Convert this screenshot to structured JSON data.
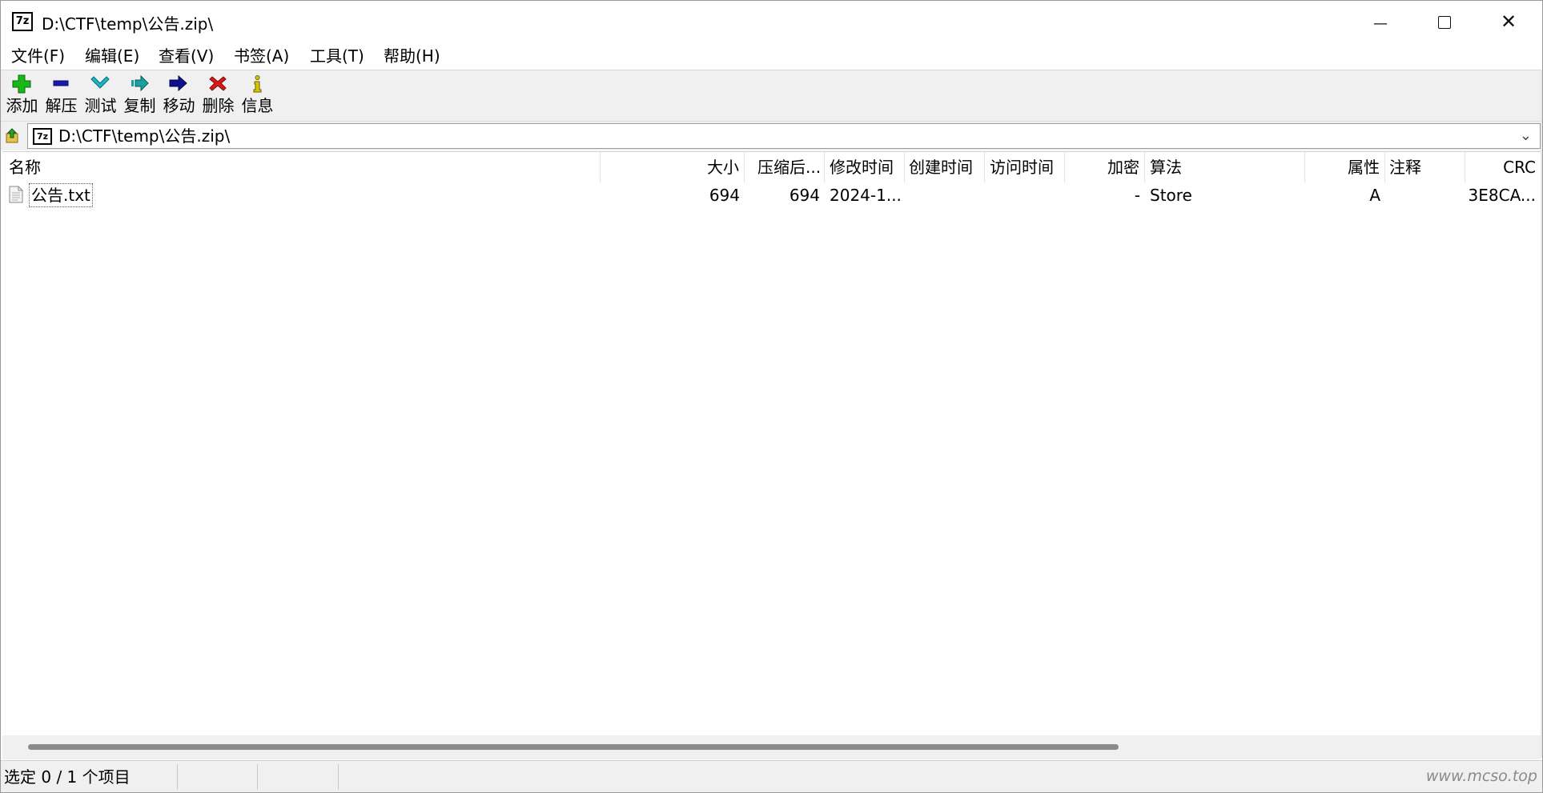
{
  "window": {
    "title": "D:\\CTF\\temp\\公告.zip\\",
    "icon_label": "7z",
    "controls": {
      "minimize": "—",
      "maximize": "",
      "close": "✕"
    }
  },
  "menu": [
    "文件(F)",
    "编辑(E)",
    "查看(V)",
    "书签(A)",
    "工具(T)",
    "帮助(H)"
  ],
  "toolbar": [
    {
      "label": "添加",
      "icon": "plus-icon",
      "color": "#18b818"
    },
    {
      "label": "解压",
      "icon": "minus-icon",
      "color": "#1a1ab0"
    },
    {
      "label": "测试",
      "icon": "check-icon",
      "color": "#18b8c8"
    },
    {
      "label": "复制",
      "icon": "copy-arrow-icon",
      "color": "#18a0a0"
    },
    {
      "label": "移动",
      "icon": "move-arrow-icon",
      "color": "#10108a"
    },
    {
      "label": "删除",
      "icon": "delete-x-icon",
      "color": "#d81818"
    },
    {
      "label": "信息",
      "icon": "info-icon",
      "color": "#d8c800"
    }
  ],
  "address": {
    "path": "D:\\CTF\\temp\\公告.zip\\",
    "dropdown": "⌄"
  },
  "columns": [
    "名称",
    "大小",
    "压缩后...",
    "修改时间",
    "创建时间",
    "访问时间",
    "加密",
    "算法",
    "属性",
    "注释",
    "CRC"
  ],
  "files": [
    {
      "name": "公告.txt",
      "size": "694",
      "packed": "694",
      "modified": "2024-1...",
      "created": "",
      "accessed": "",
      "encrypted": "-",
      "method": "Store",
      "attributes": "A",
      "comment": "",
      "crc": "3E8CA..."
    }
  ],
  "status": {
    "selection": "选定 0 / 1 个项目"
  },
  "watermark": "www.mcso.top"
}
